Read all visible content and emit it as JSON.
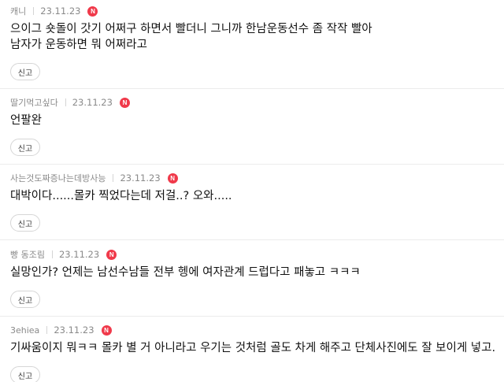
{
  "comments": [
    {
      "author": "캐니",
      "date": "23.11.23",
      "badge": "N",
      "lines": [
        "으이그 숏돌이 갓기 어쩌구 하면서 빨더니 그니까 한남운동선수 좀 작작 빨아",
        "남자가 운동하면 뭐 어쩌라고"
      ],
      "report_label": "신고"
    },
    {
      "author": "딸기먹고싶다",
      "date": "23.11.23",
      "badge": "N",
      "lines": [
        "언팔완"
      ],
      "report_label": "신고"
    },
    {
      "author": "사는것도짜증나는데방사능",
      "date": "23.11.23",
      "badge": "N",
      "lines": [
        "대박이다......몰카 찍었다는데 저걸..? 오와....."
      ],
      "report_label": "신고"
    },
    {
      "author": "빵 동조림",
      "date": "23.11.23",
      "badge": "N",
      "lines": [
        "실망인가? 언제는 남선수남들 전부 헹에 여자관계 드럽다고 패놓고 ㅋㅋㅋ"
      ],
      "report_label": "신고"
    },
    {
      "author": "3ehiea",
      "date": "23.11.23",
      "badge": "N",
      "lines": [
        "기싸움이지 뭐ㅋㅋ 몰카 별 거 아니라고 우기는 것처럼 골도 차게 해주고 단체사진에도 잘 보이게 넣고..."
      ],
      "report_label": "신고"
    }
  ],
  "colors": {
    "badge": "#f0394a",
    "meta_text": "#8a8a8a",
    "body_text": "#111111",
    "divider": "#ececec"
  }
}
